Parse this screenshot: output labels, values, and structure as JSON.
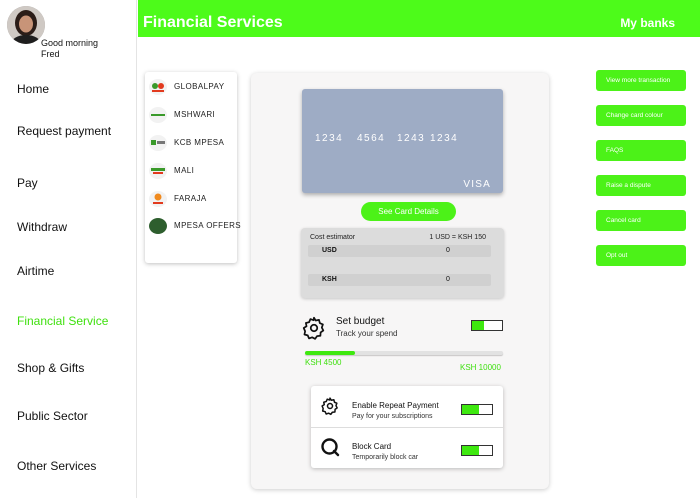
{
  "user": {
    "greeting_line1": "Good morning",
    "greeting_line2": "Fred"
  },
  "sidebar": {
    "items": [
      {
        "label": "Home",
        "active": false
      },
      {
        "label": "Request payment",
        "active": false
      },
      {
        "label": "Pay",
        "active": false
      },
      {
        "label": "Withdraw",
        "active": false
      },
      {
        "label": "Airtime",
        "active": false
      },
      {
        "label": "Financial Service",
        "active": true
      },
      {
        "label": "Shop & Gifts",
        "active": false
      },
      {
        "label": "Public Sector",
        "active": false
      },
      {
        "label": "Other Services",
        "active": false
      }
    ]
  },
  "header": {
    "title": "Financial Services",
    "right_link": "My banks"
  },
  "banks": [
    {
      "name": "GLOBALPAY",
      "logo_icon": "globalpay-logo-icon"
    },
    {
      "name": "MSHWARI",
      "logo_icon": "mshwari-logo-icon"
    },
    {
      "name": "KCB MPESA",
      "logo_icon": "kcb-logo-icon"
    },
    {
      "name": "MALI",
      "logo_icon": "safaricom-logo-icon"
    },
    {
      "name": "FARAJA",
      "logo_icon": "faraja-logo-icon"
    },
    {
      "name": "MPESA OFFERS",
      "logo_icon": "mpesa-offers-logo-icon"
    }
  ],
  "card": {
    "number_groups": [
      "1234",
      "4564",
      "1243",
      "1234"
    ],
    "brand": "VISA",
    "details_button": "See Card Details"
  },
  "estimator": {
    "title": "Cost estimator",
    "rate": "1 USD = KSH 150",
    "rows": [
      {
        "label": "USD",
        "value": "0"
      },
      {
        "label": "KSH",
        "value": "0"
      }
    ]
  },
  "budget": {
    "title": "Set budget",
    "subtitle": "Track your spend",
    "min_label": "KSH 4500",
    "max_label": "KSH 10000",
    "progress_fraction": 0.25,
    "toggle_fill_fraction": 0.4
  },
  "options": [
    {
      "title": "Enable Repeat Payment",
      "subtitle": "Pay for your subscriptions",
      "icon": "gear-icon",
      "toggle_fill_fraction": 0.55
    },
    {
      "title": "Block Card",
      "subtitle": "Temporarily block car",
      "icon": "search-q-icon",
      "toggle_fill_fraction": 0.55
    }
  ],
  "actions": [
    "View more transaction",
    "Change card colour",
    "FAQS",
    "Raise a dispute",
    "Cancel card",
    "Opt out"
  ],
  "colors": {
    "accent": "#4dfb1a",
    "card": "#9eacc5",
    "active_nav": "#3fe00f"
  }
}
